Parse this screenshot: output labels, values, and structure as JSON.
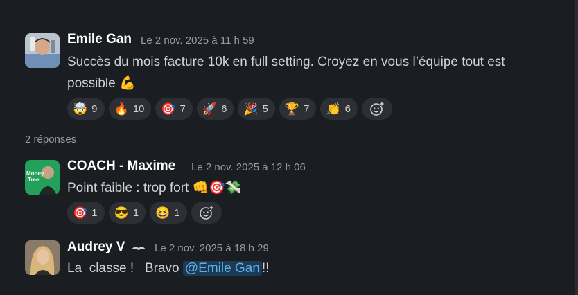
{
  "messages": [
    {
      "author": "Emile Gan",
      "timestamp": "Le 2 nov. 2025 à 11 h 59",
      "text_line1": "Succès du mois facture 10k en full setting. Croyez en vous l’équipe tout est",
      "text_line2": "possible 💪",
      "reactions": [
        {
          "emoji": "🤯",
          "count": "9"
        },
        {
          "emoji": "🔥",
          "count": "10"
        },
        {
          "emoji": "🎯",
          "count": "7"
        },
        {
          "emoji": "🚀",
          "count": "6"
        },
        {
          "emoji": "🎉",
          "count": "5"
        },
        {
          "emoji": "🏆",
          "count": "7"
        },
        {
          "emoji": "👏",
          "count": "6"
        }
      ]
    }
  ],
  "thread": {
    "replies_label": "2 réponses"
  },
  "replies": [
    {
      "author": "COACH - Maxime",
      "timestamp": "Le 2 nov. 2025 à 12 h 06",
      "text": "Point faible : trop fort 👊🎯💸",
      "reactions": [
        {
          "emoji": "🎯",
          "count": "1"
        },
        {
          "emoji": "😎",
          "count": "1"
        },
        {
          "emoji": "😆",
          "count": "1"
        }
      ],
      "avatar_text": "Money Tree"
    },
    {
      "author": "Audrey V",
      "timestamp": "Le 2 nov. 2025 à 18 h 29",
      "text_prefix": "La  classe !   Bravo ",
      "mention": "@Emile Gan",
      "text_suffix": "!!"
    }
  ],
  "icons": {
    "add_reaction": "add-reaction-icon",
    "status": "mustache-icon"
  }
}
